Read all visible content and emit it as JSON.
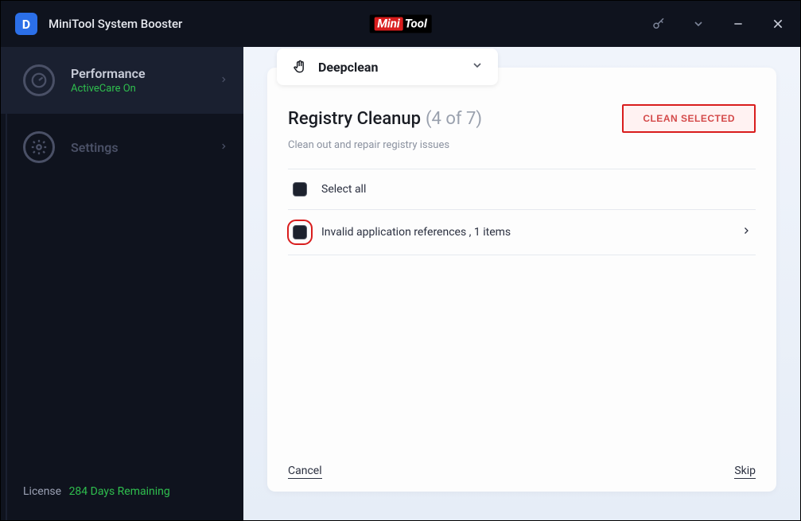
{
  "app": {
    "title": "MiniTool System Booster",
    "icon_letter": "D",
    "brand_part1": "Mini",
    "brand_part2": "Tool"
  },
  "sidebar": {
    "items": [
      {
        "label": "Performance",
        "sub": "ActiveCare On",
        "active": true
      },
      {
        "label": "Settings",
        "sub": "",
        "active": false
      }
    ],
    "license_label": "License",
    "license_value": "284 Days Remaining"
  },
  "mode": {
    "label": "Deepclean"
  },
  "content": {
    "title": "Registry Cleanup",
    "step": "(4 of 7)",
    "subtitle": "Clean out and repair registry issues",
    "clean_button": "CLEAN SELECTED",
    "select_all": "Select all",
    "items": [
      {
        "label": "Invalid application references ,  1 items"
      }
    ],
    "cancel": "Cancel",
    "skip": "Skip"
  }
}
